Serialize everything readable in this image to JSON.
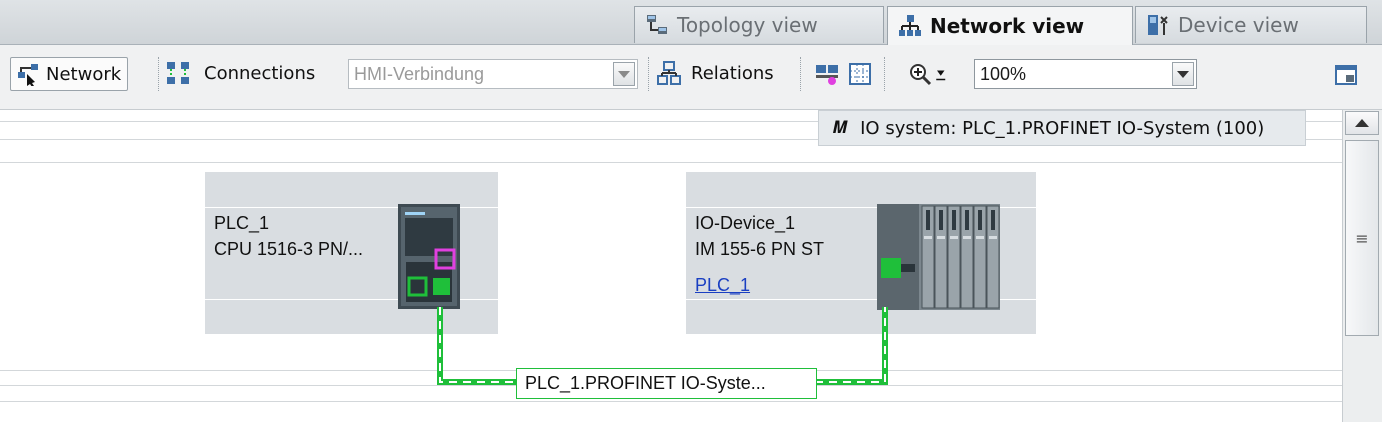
{
  "tabs": [
    {
      "label": "Topology view",
      "icon": "topology-icon",
      "active": false
    },
    {
      "label": "Network view",
      "icon": "network-view-icon",
      "active": true
    },
    {
      "label": "Device view",
      "icon": "device-view-icon",
      "active": false
    }
  ],
  "toolbar": {
    "network_label": "Network",
    "connections_label": "Connections",
    "connection_type_value": "HMI-Verbindung",
    "relations_label": "Relations",
    "zoom_value": "100%"
  },
  "canvas": {
    "tooltip_text": "IO system: PLC_1.PROFINET IO-System (100)",
    "devices": [
      {
        "name": "PLC_1",
        "type": "CPU 1516-3 PN/..."
      },
      {
        "name": "IO-Device_1",
        "type": "IM 155-6 PN ST",
        "assignment": "PLC_1"
      }
    ],
    "subnet_label": "PLC_1.PROFINET IO-Syste..."
  },
  "colors": {
    "profinet_line": "#1fbf3a",
    "device_box": "#d9dde1",
    "port_highlight": "#e040e0",
    "link": "#1a3fc2"
  }
}
